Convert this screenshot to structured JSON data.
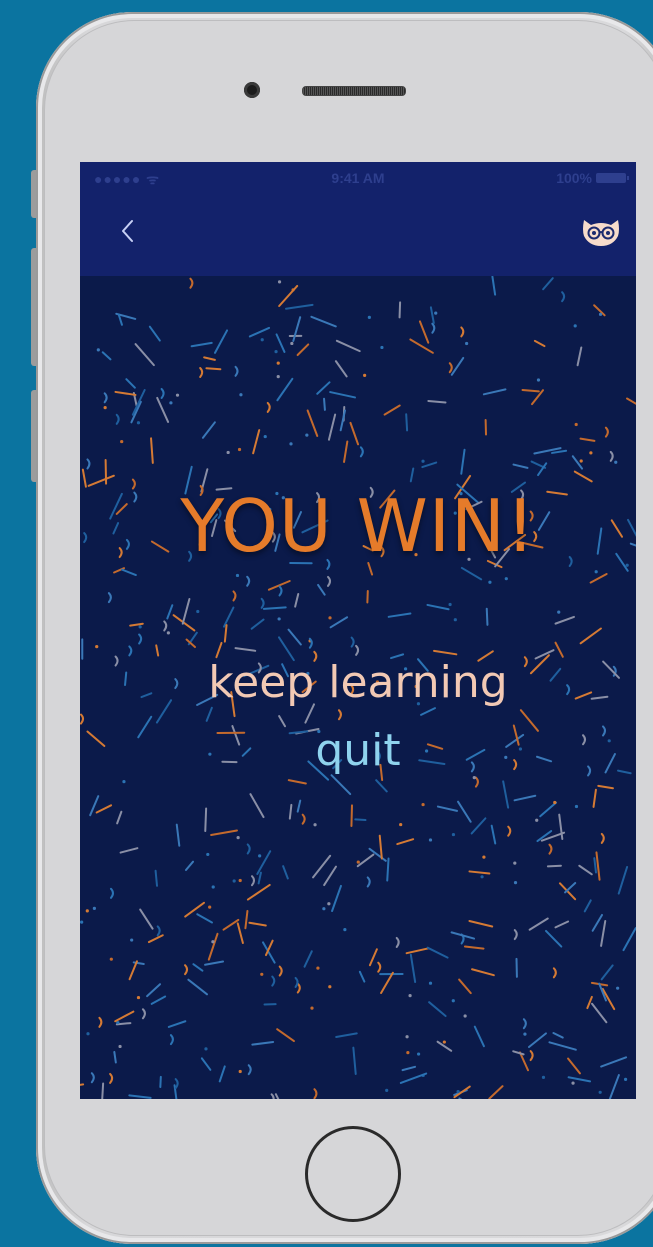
{
  "status_bar": {
    "signal": "●●●●● ᯤ",
    "time": "9:41 AM",
    "battery_label": "100%"
  },
  "nav": {
    "back_icon": "chevron-left-icon",
    "profile_icon": "owl-icon"
  },
  "game_result": {
    "title": "YOU WIN!",
    "keep_learning_label": "keep learning",
    "quit_label": "quit"
  },
  "colors": {
    "page_background": "#0b74a0",
    "nav_background": "#13226b",
    "content_background": "#0b1a4a",
    "title_color": "#e57b2a",
    "keep_learning_color": "#f2c9b4",
    "quit_color": "#8fd3ee"
  }
}
